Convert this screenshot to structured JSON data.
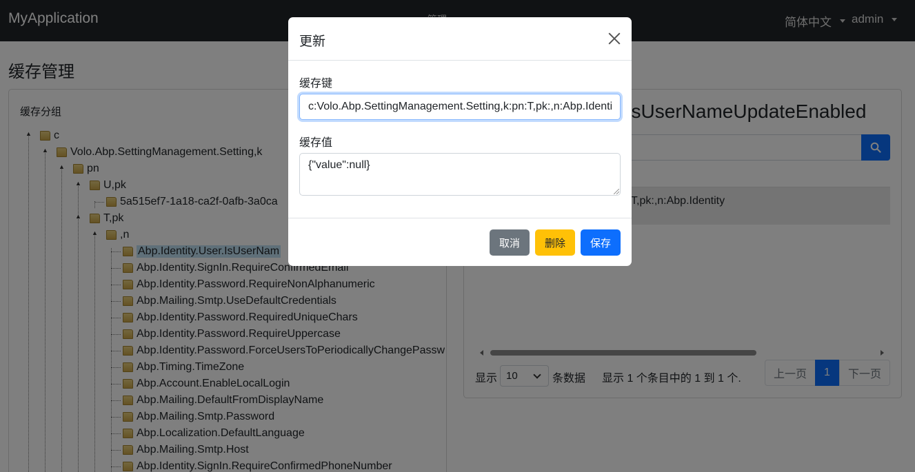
{
  "navbar": {
    "brand": "MyApplication",
    "center_menu": "管理",
    "language": "简体中文",
    "user": "admin"
  },
  "page": {
    "title": "缓存管理"
  },
  "tree": {
    "heading": "缓存分组",
    "nodes": [
      "c",
      "Volo.Abp.SettingManagement.Setting,k",
      "pn",
      "U,pk",
      "5a515ef7-1a18-ca2f-0afb-3a0ca",
      "T,pk",
      ",n",
      "Abp.Identity.User.IsUserNam",
      "Abp.Identity.SignIn.RequireConfirmedEmail",
      "Abp.Identity.Password.RequireNonAlphanumeric",
      "Abp.Mailing.Smtp.UseDefaultCredentials",
      "Abp.Identity.Password.RequiredUniqueChars",
      "Abp.Identity.Password.RequireUppercase",
      "Abp.Identity.Password.ForceUsersToPeriodicallyChangePassw",
      "Abp.Timing.TimeZone",
      "Abp.Account.EnableLocalLogin",
      "Abp.Mailing.DefaultFromDisplayName",
      "Abp.Mailing.Smtp.Password",
      "Abp.Localization.DefaultLanguage",
      "Abp.Mailing.Smtp.Host",
      "Abp.Identity.SignIn.RequireConfirmedPhoneNumber"
    ]
  },
  "detail": {
    "title": ".IsUserNameUpdateEnabled",
    "row_text": "ttingManagement.Setting,k:pn:T,pk:,n:Abp.Identity",
    "show_label": "显示",
    "page_size": "10",
    "entries_label": "条数据",
    "summary": "显示 1 个条目中的 1 到 1 个.",
    "prev": "上一页",
    "current_page": "1",
    "next": "下一页"
  },
  "modal": {
    "title": "更新",
    "key_label": "缓存键",
    "key_value": "c:Volo.Abp.SettingManagement.Setting,k:pn:T,pk:,n:Abp.Identity.User.IsUserNameUpdateEnabled",
    "value_label": "缓存值",
    "value_text": "{\"value\":null}",
    "cancel": "取消",
    "delete": "删除",
    "save": "保存"
  },
  "colors": {
    "navbar": "#212529",
    "primary": "#0d6efd",
    "warning": "#ffc107",
    "secondary": "#6c757d",
    "selected_node": "#bfe0f3"
  },
  "icons": {
    "search": "search-icon",
    "close": "close-icon",
    "folder": "folder-icon",
    "caret": "chevron-down-icon"
  }
}
